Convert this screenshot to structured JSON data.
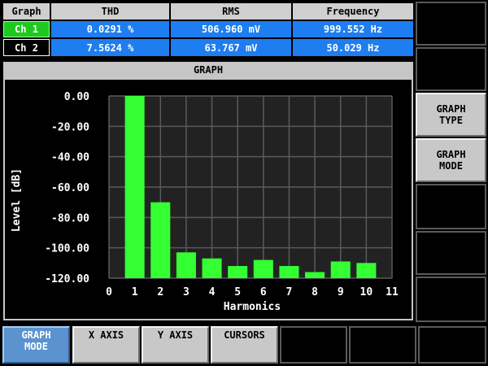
{
  "measurement_table": {
    "headers": [
      "Graph",
      "THD",
      "RMS",
      "Frequency"
    ],
    "rows": [
      {
        "channel": "Ch 1",
        "thd": "0.0291 %",
        "rms": "506.960 mV",
        "frequency": "999.552 Hz",
        "channel_color": "#1fc81f"
      },
      {
        "channel": "Ch 2",
        "thd": "7.5624 %",
        "rms": "63.767 mV",
        "frequency": "50.029 Hz",
        "channel_color": "#000000"
      }
    ]
  },
  "graph_panel": {
    "title": "GRAPH"
  },
  "right_softkeys": {
    "graph_type": [
      "GRAPH",
      "TYPE"
    ],
    "graph_mode": [
      "GRAPH",
      "MODE"
    ]
  },
  "bottom_softkeys": {
    "graph_mode": [
      "GRAPH",
      "MODE"
    ],
    "x_axis": "X AXIS",
    "y_axis": "Y AXIS",
    "cursors": "CURSORS"
  },
  "colors": {
    "bar": "#33ff33",
    "value_cell": "#1e7df0",
    "selected_key": "#5b93cf"
  },
  "chart_data": {
    "type": "bar",
    "xlabel": "Harmonics",
    "ylabel": "Level [dB]",
    "xlim": [
      0,
      11
    ],
    "ylim": [
      -120,
      0
    ],
    "x_ticks": [
      "0",
      "1",
      "2",
      "3",
      "4",
      "5",
      "6",
      "7",
      "8",
      "9",
      "10",
      "11"
    ],
    "y_ticks": [
      "0.00",
      "-20.00",
      "-40.00",
      "-60.00",
      "-80.00",
      "-100.00",
      "-120.00"
    ],
    "categories": [
      1,
      2,
      3,
      4,
      5,
      6,
      7,
      8,
      9,
      10
    ],
    "values": [
      0,
      -70,
      -103,
      -107,
      -112,
      -108,
      -112,
      -116,
      -109,
      -110
    ],
    "grid": true
  }
}
